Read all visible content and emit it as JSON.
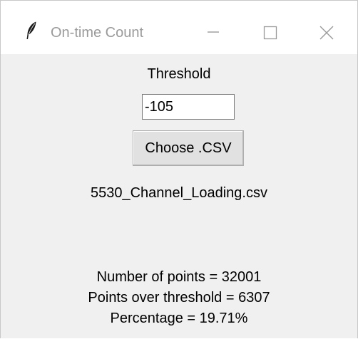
{
  "window": {
    "title": "On-time Count",
    "icon": "feather-icon"
  },
  "titlebar_controls": [
    "minimize-icon",
    "maximize-icon",
    "close-icon"
  ],
  "form": {
    "threshold_label": "Threshold",
    "threshold_value": "-105",
    "choose_button_label": "Choose .CSV",
    "selected_file": "5530_Channel_Loading.csv"
  },
  "results": {
    "points_line": "Number of points = 32001",
    "over_line": "Points over threshold = 6307",
    "percent_line": "Percentage = 19.71%"
  }
}
